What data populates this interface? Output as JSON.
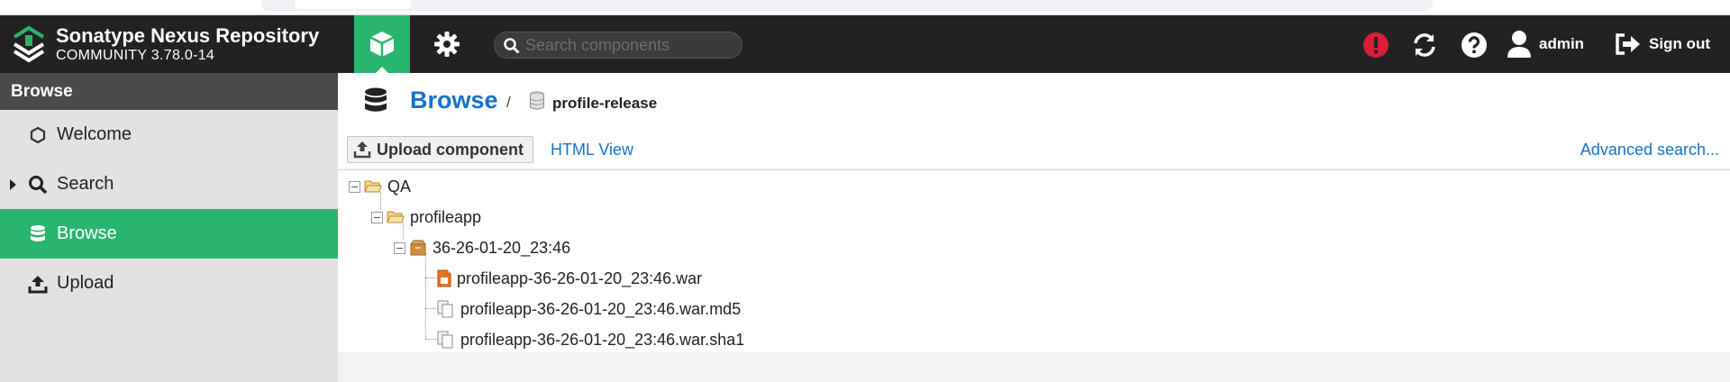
{
  "app": {
    "brand_name": "Sonatype Nexus Repository",
    "brand_version": "COMMUNITY 3.78.0-14"
  },
  "header": {
    "search_placeholder": "Search components",
    "user_label": "admin",
    "signout_label": "Sign out",
    "accent_color": "#2ab56f",
    "alert_color": "#d61f39"
  },
  "sidebar": {
    "title": "Browse",
    "items": [
      {
        "label": "Welcome",
        "icon": "hexagon-icon"
      },
      {
        "label": "Search",
        "icon": "search-icon"
      },
      {
        "label": "Browse",
        "icon": "database-icon"
      },
      {
        "label": "Upload",
        "icon": "upload-icon"
      }
    ]
  },
  "main": {
    "breadcrumb_title": "Browse",
    "breadcrumb_sep": "/",
    "repository": "profile-release",
    "upload_button": "Upload component",
    "html_view": "HTML View",
    "advanced_search": "Advanced search..."
  },
  "tree": {
    "folder": "QA",
    "subfolder": "profileapp",
    "component": "36-26-01-20_23:46",
    "files": [
      "profileapp-36-26-01-20_23:46.war",
      "profileapp-36-26-01-20_23:46.war.md5",
      "profileapp-36-26-01-20_23:46.war.sha1"
    ]
  }
}
